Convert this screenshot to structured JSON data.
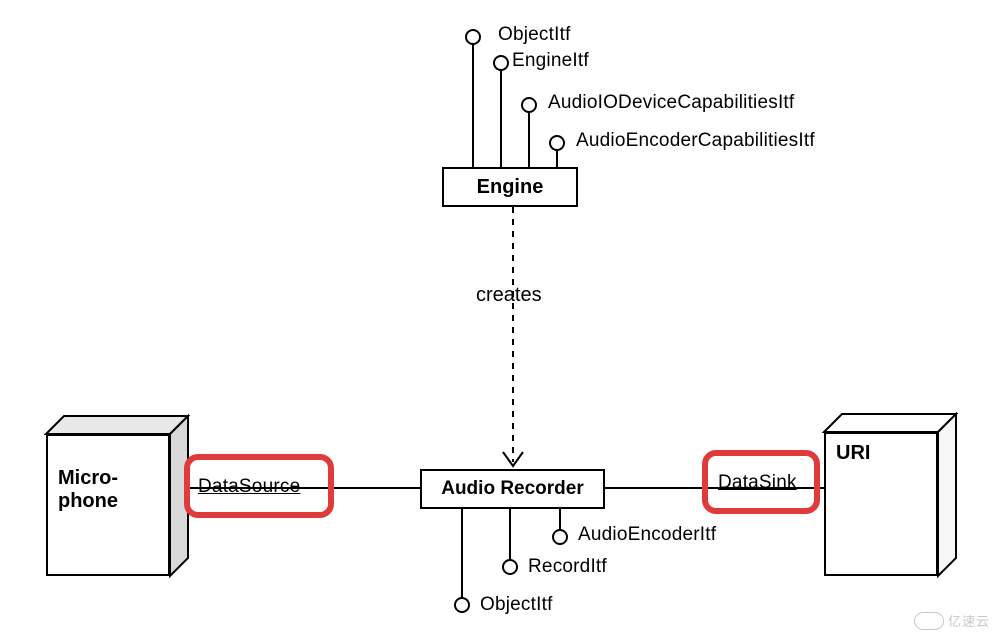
{
  "engine": {
    "name": "Engine",
    "interfaces": [
      "ObjectItf",
      "EngineItf",
      "AudioIODeviceCapabilitiesItf",
      "AudioEncoderCapabilitiesItf"
    ]
  },
  "relation": {
    "label": "creates"
  },
  "recorder": {
    "name": "Audio Recorder",
    "interfaces": [
      "AudioEncoderItf",
      "RecordItf",
      "ObjectItf"
    ]
  },
  "source": {
    "device": "Micro-\nphone",
    "port_label": "DataSource"
  },
  "sink": {
    "device": "URI",
    "port_label": "DataSink"
  },
  "watermark": "亿速云"
}
